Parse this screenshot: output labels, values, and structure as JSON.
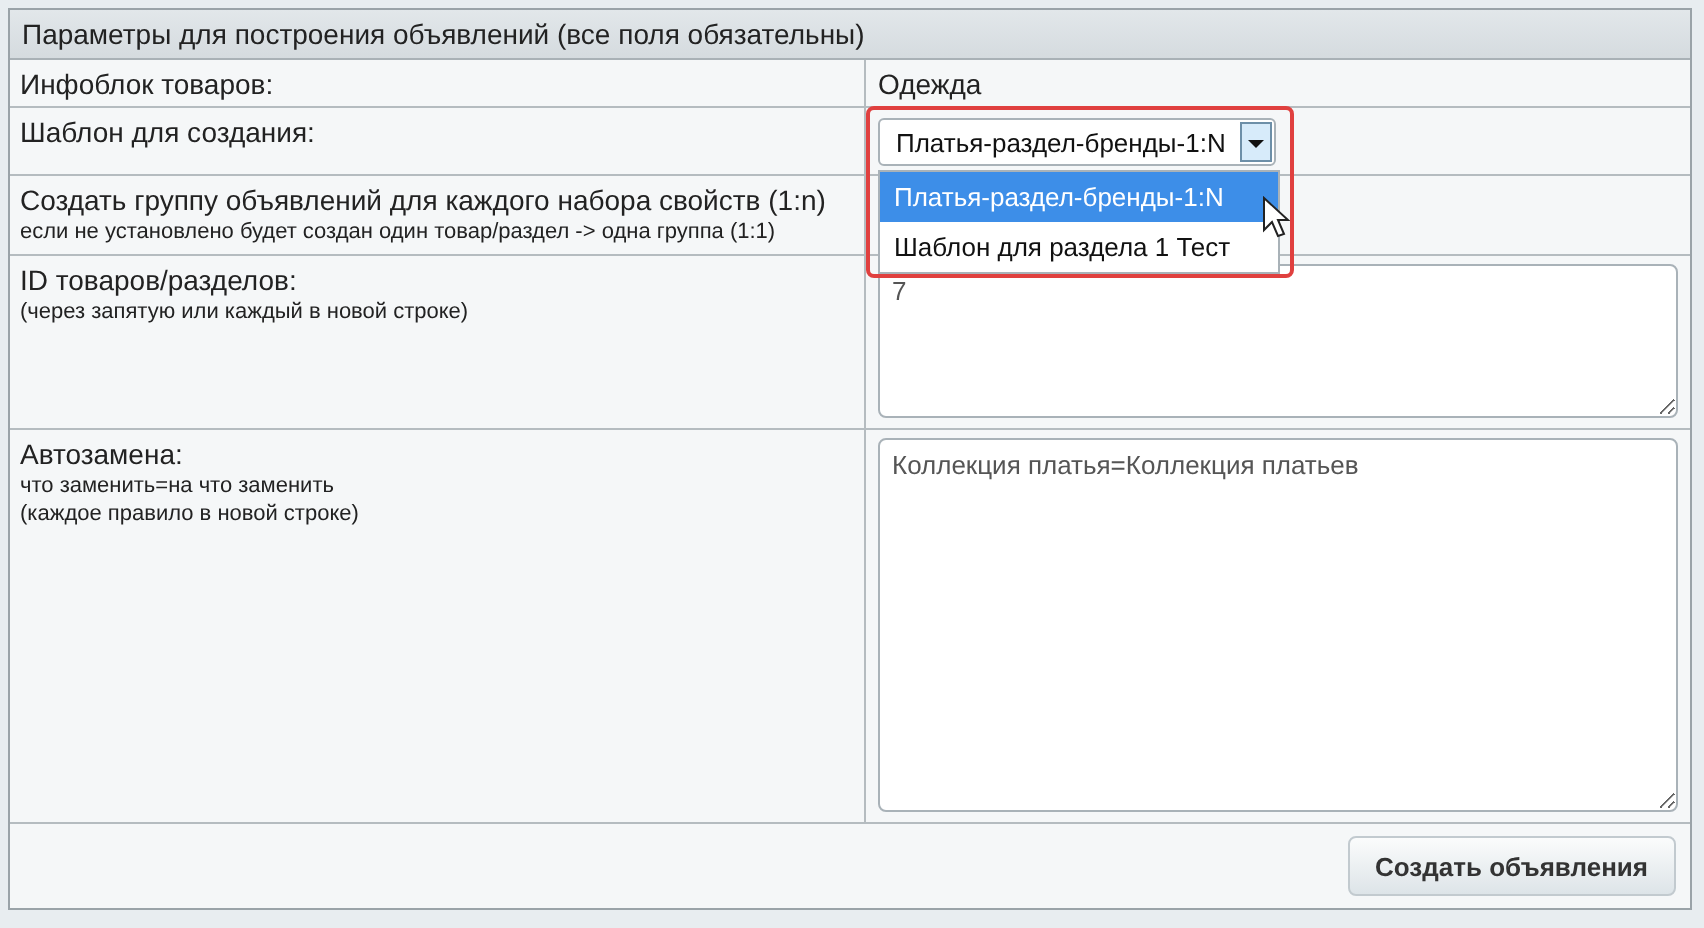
{
  "title": "Параметры для построения объявлений (все поля обязательны)",
  "rows": [
    {
      "kind": "text",
      "label": "Инфоблок товаров:",
      "value": "Одежда"
    },
    {
      "kind": "select",
      "label": "Шаблон для создания:",
      "value": "Платья-раздел-бренды-1:N",
      "open": true,
      "highlighted": true,
      "options": [
        {
          "label": "Платья-раздел-бренды-1:N",
          "selected": true
        },
        {
          "label": "Шаблон для раздела 1 Тест",
          "selected": false
        }
      ]
    },
    {
      "kind": "covered",
      "label": "Создать группу объявлений для каждого набора свойств (1:n)",
      "hint": "если не установлено будет создан один товар/раздел -> одна группа (1:1)"
    },
    {
      "kind": "textarea",
      "label": "ID товаров/разделов:",
      "hints": [
        "(через запятую или каждый в новой строке)"
      ],
      "value": "7"
    },
    {
      "kind": "textarea",
      "label": "Автозамена:",
      "hints": [
        "что заменить=на что заменить",
        "(каждое правило в новой строке)"
      ],
      "value": "Коллекция платья=Коллекция платьев"
    }
  ],
  "submit": "Создать объявления"
}
